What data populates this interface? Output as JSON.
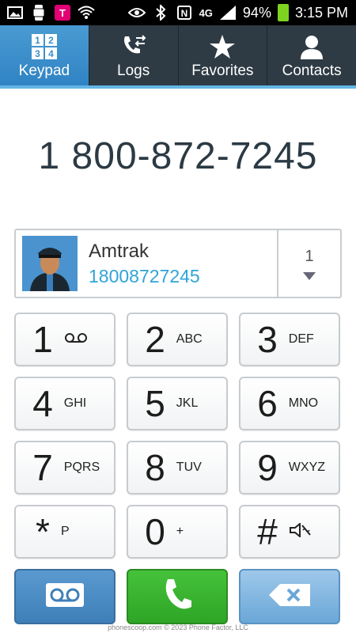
{
  "status_bar": {
    "battery": "94%",
    "time": "3:15 PM",
    "network": "4G",
    "icons": [
      "image-icon",
      "watch-icon",
      "tmobile-icon",
      "wifi-icon",
      "eye-icon",
      "bluetooth-icon",
      "nfc-icon",
      "signal-icon",
      "battery-icon"
    ]
  },
  "tabs": [
    {
      "label": "Keypad",
      "icon": "keypad-icon",
      "active": true
    },
    {
      "label": "Logs",
      "icon": "logs-icon",
      "active": false
    },
    {
      "label": "Favorites",
      "icon": "star-icon",
      "active": false
    },
    {
      "label": "Contacts",
      "icon": "person-icon",
      "active": false
    }
  ],
  "dialed_number": "1 800-872-7245",
  "contact_match": {
    "name": "Amtrak",
    "number": "18008727245",
    "match_count": "1"
  },
  "keys": [
    {
      "digit": "1",
      "letters": ""
    },
    {
      "digit": "2",
      "letters": "ABC"
    },
    {
      "digit": "3",
      "letters": "DEF"
    },
    {
      "digit": "4",
      "letters": "GHI"
    },
    {
      "digit": "5",
      "letters": "JKL"
    },
    {
      "digit": "6",
      "letters": "MNO"
    },
    {
      "digit": "7",
      "letters": "PQRS"
    },
    {
      "digit": "8",
      "letters": "TUV"
    },
    {
      "digit": "9",
      "letters": "WXYZ"
    },
    {
      "digit": "*",
      "letters": "P"
    },
    {
      "digit": "0",
      "letters": "+"
    },
    {
      "digit": "#",
      "letters": ""
    }
  ],
  "actions": {
    "voicemail": "voicemail-icon",
    "call": "phone-icon",
    "delete": "backspace-icon"
  },
  "watermark": "phonescoop.com © 2023 Phone Factor, LLC",
  "colors": {
    "tab_active": "#3b8fcb",
    "tab_bg": "#2e3b44",
    "call_green": "#3bb52f",
    "link_blue": "#2fa4d8"
  }
}
